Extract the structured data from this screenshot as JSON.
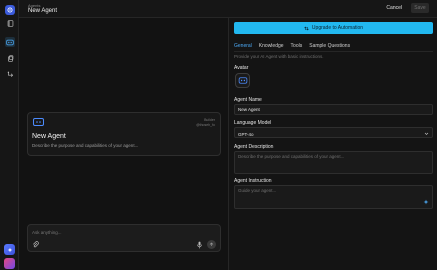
{
  "header": {
    "breadcrumb": "Agents",
    "title": "New Agent",
    "cancel_label": "Cancel",
    "save_label": "Save"
  },
  "rail": {
    "items": [
      {
        "icon": "logo-icon"
      },
      {
        "icon": "book-icon"
      },
      {
        "icon": "agent-icon",
        "active": true
      },
      {
        "icon": "document-icon"
      },
      {
        "icon": "workflow-icon"
      }
    ]
  },
  "preview": {
    "card": {
      "builder_label": "Builder",
      "builder_handle": "@thoseh_fo",
      "name": "New Agent",
      "description": "Describe the purpose and capabilities of your agent..."
    },
    "chat": {
      "placeholder": "Ask anything..."
    }
  },
  "panel": {
    "upgrade_label": "Upgrade to Automation",
    "tabs": [
      {
        "label": "General",
        "active": true
      },
      {
        "label": "Knowledge"
      },
      {
        "label": "Tools"
      },
      {
        "label": "Sample Questions"
      }
    ],
    "hint": "Provide your AI Agent with basic instructions.",
    "avatar_label": "Avatar",
    "name_label": "Agent Name",
    "name_value": "New Agent",
    "model_label": "Language Model",
    "model_value": "GPT-4o",
    "description_label": "Agent Description",
    "description_placeholder": "Describe the purpose and capabilities of your agent...",
    "instruction_label": "Agent Instruction",
    "instruction_placeholder": "Guide your agent..."
  },
  "colors": {
    "accent": "#22b8f0",
    "tab_active": "#4dabf7",
    "background": "#141414"
  }
}
